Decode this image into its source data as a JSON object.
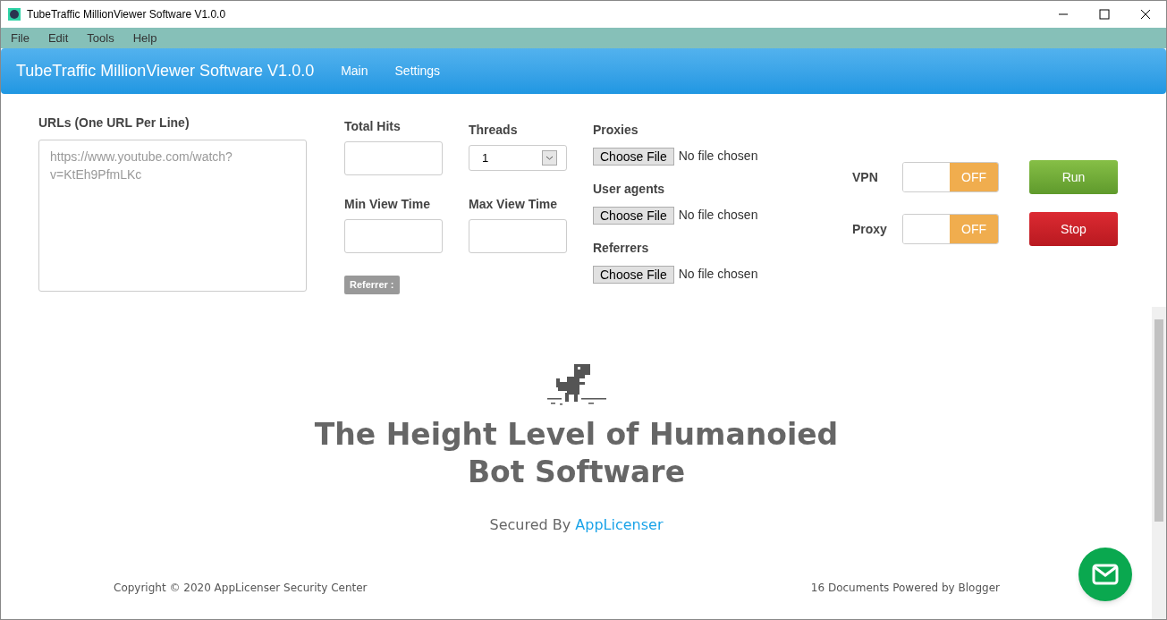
{
  "window": {
    "title": "TubeTraffic MillionViewer Software V1.0.0"
  },
  "menu": [
    "File",
    "Edit",
    "Tools",
    "Help"
  ],
  "navbar": {
    "brand": "TubeTraffic MillionViewer Software V1.0.0",
    "links": [
      {
        "label": "Main"
      },
      {
        "label": "Settings"
      }
    ]
  },
  "urls": {
    "label": "URLs (One URL Per Line)",
    "placeholder": "https://www.youtube.com/watch?v=KtEh9PfmLKc"
  },
  "total_hits": {
    "label": "Total Hits"
  },
  "threads": {
    "label": "Threads",
    "value": "1"
  },
  "min_view_time": {
    "label": "Min View Time"
  },
  "max_view_time": {
    "label": "Max View Time"
  },
  "referrer_badge": "Referrer :",
  "files": [
    {
      "label": "Proxies",
      "button": "Choose File",
      "status": "No file chosen"
    },
    {
      "label": "User agents",
      "button": "Choose File",
      "status": "No file chosen"
    },
    {
      "label": "Referrers",
      "button": "Choose File",
      "status": "No file chosen"
    }
  ],
  "switches": [
    {
      "label": "VPN",
      "on": false,
      "state_label": "OFF"
    },
    {
      "label": "Proxy",
      "on": false,
      "state_label": "OFF"
    }
  ],
  "actions": [
    {
      "label": "Run",
      "kind": "run"
    },
    {
      "label": "Stop",
      "kind": "stop"
    }
  ],
  "hero": {
    "headline": "The Height Level of Humanoied Bot Software",
    "secured_by": "Secured By",
    "link": "AppLicenser"
  },
  "footer": {
    "copyright": "Copyright © 2020 AppLicenser Security Center",
    "right": "16 Documents Powered by Blogger"
  }
}
